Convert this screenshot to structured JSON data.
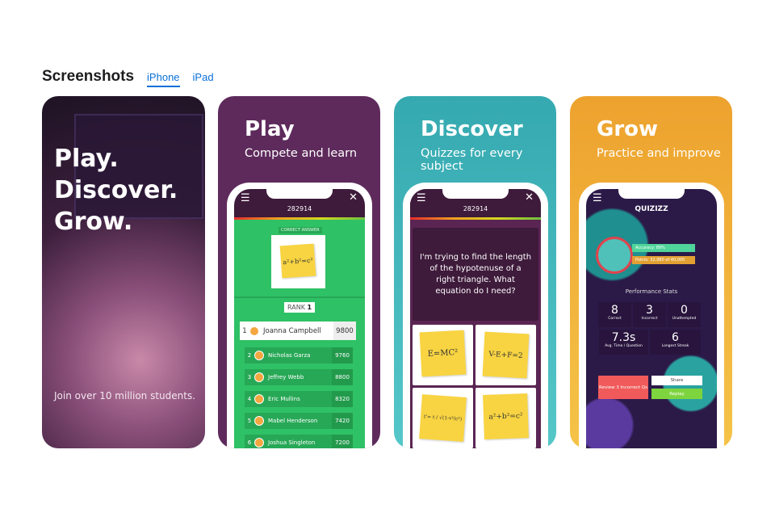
{
  "header": {
    "title": "Screenshots",
    "tabs": [
      {
        "label": "iPhone",
        "active": true
      },
      {
        "label": "iPad",
        "active": false
      }
    ]
  },
  "colors": {
    "accent": "#0a70d8",
    "play": "#5e2a5c",
    "discover": "#3fb4bb",
    "grow": "#f0b030",
    "quiz_green": "#2fc165"
  },
  "cards": [
    {
      "headline": [
        "Play.",
        "Discover.",
        "Grow."
      ],
      "caption": "Join over 10 million students."
    },
    {
      "title": "Play",
      "subtitle": "Compete and learn",
      "screen": {
        "code": "282914",
        "correct_label": "CORRECT ANSWER",
        "answer": "a²+b²=c²",
        "rank_label": "RANK",
        "rank": "1",
        "leaderboard": [
          {
            "rank": "1",
            "name": "Joanna Campbell",
            "score": "9800"
          },
          {
            "rank": "2",
            "name": "Nicholas Garza",
            "score": "9760"
          },
          {
            "rank": "3",
            "name": "Jeffrey Webb",
            "score": "8800"
          },
          {
            "rank": "4",
            "name": "Eric Mullins",
            "score": "8320"
          },
          {
            "rank": "5",
            "name": "Mabel Henderson",
            "score": "7420"
          },
          {
            "rank": "6",
            "name": "Joshua Singleton",
            "score": "7200"
          }
        ]
      }
    },
    {
      "title": "Discover",
      "subtitle": "Quizzes for every subject",
      "screen": {
        "code": "282914",
        "question": "I'm trying to find the length of the hypotenuse of a right triangle. What equation do I need?",
        "options": [
          "E=MC²",
          "V-E+F=2",
          "t'= t / √(1-v²/c²)",
          "a²+b²=c²"
        ]
      }
    },
    {
      "title": "Grow",
      "subtitle": "Practice and improve",
      "screen": {
        "logo": "QUIZIZZ",
        "accuracy": "Accuracy: 89%",
        "points": "Points: 32,980 of 40,000",
        "stats_title": "Performance Stats",
        "stats": [
          {
            "value": "8",
            "label": "Correct"
          },
          {
            "value": "3",
            "label": "Incorrect"
          },
          {
            "value": "0",
            "label": "Unattempted"
          },
          {
            "value": "7.3s",
            "label": "Avg. Time / Question"
          },
          {
            "value": "6",
            "label": "Longest Streak"
          }
        ],
        "review": "Review 3 Incorrect Qs",
        "share": "Share",
        "replay": "Replay"
      }
    }
  ],
  "icons": {
    "menu": "hamburger-icon",
    "close": "close-icon"
  }
}
